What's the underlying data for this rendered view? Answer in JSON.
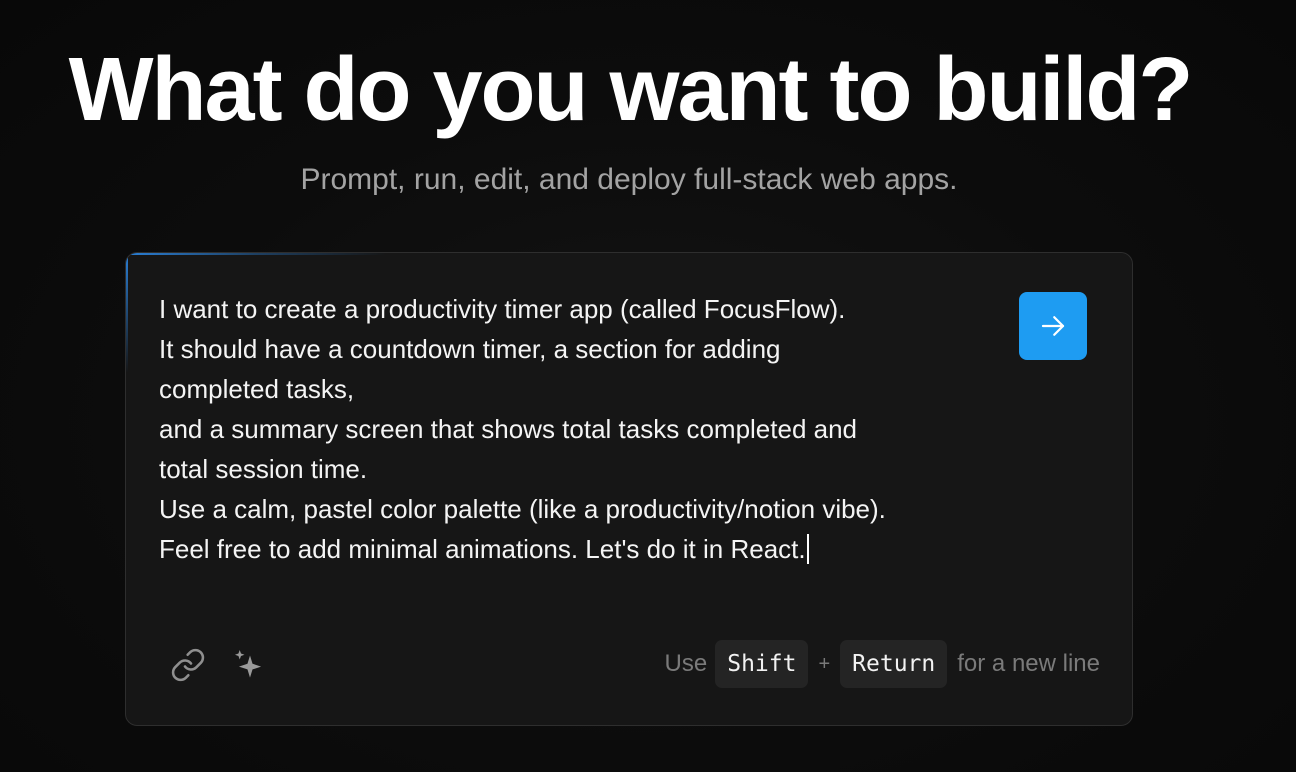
{
  "hero": {
    "title": "What do you want to build?",
    "subtitle": "Prompt, run, edit, and deploy full-stack web apps."
  },
  "prompt": {
    "value": "I want to create a productivity timer app (called FocusFlow).\nIt should have a countdown timer, a section for adding\ncompleted tasks,\nand a summary screen that shows total tasks completed and\ntotal session time.\nUse a calm, pastel color palette (like a productivity/notion vibe).\nFeel free to add minimal animations. Let's do it in React."
  },
  "toolbar": {
    "attach_icon": "link-icon",
    "enhance_icon": "sparkles-icon",
    "send_icon": "arrow-right-icon"
  },
  "hint": {
    "prefix": "Use",
    "key1": "Shift",
    "plus": "+",
    "key2": "Return",
    "suffix": "for a new line"
  },
  "colors": {
    "accent": "#1e9cf2",
    "background": "#0b0b0b",
    "card": "#161616",
    "muted_text": "#a3a3a3"
  }
}
